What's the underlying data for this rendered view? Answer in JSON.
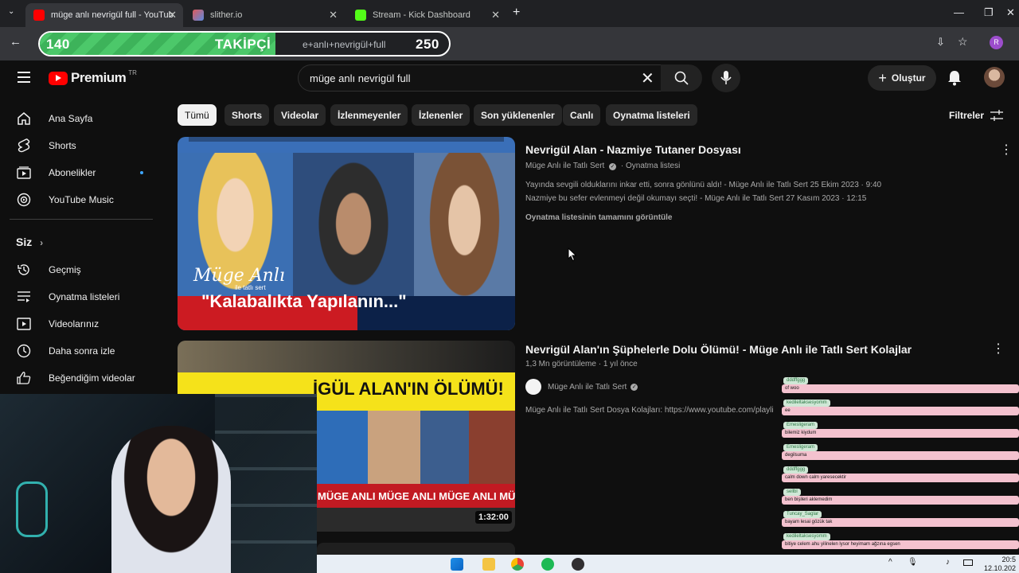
{
  "browser": {
    "tabs": [
      {
        "title": "müge anlı nevrigül full - YouTub"
      },
      {
        "title": "slither.io"
      },
      {
        "title": "Stream - Kick Dashboard"
      }
    ],
    "address": "e+anlı+nevrigül+full",
    "overlay": {
      "left": "140",
      "label": "TAKİPÇİ",
      "right": "250"
    }
  },
  "youtube": {
    "logo": "Premium",
    "region": "TR",
    "search_value": "müge anlı nevrigül full",
    "create_label": "Oluştur",
    "sidebar": {
      "items": [
        {
          "label": "Ana Sayfa",
          "icon": "home-icon"
        },
        {
          "label": "Shorts",
          "icon": "shorts-icon"
        },
        {
          "label": "Abonelikler",
          "icon": "subscriptions-icon"
        },
        {
          "label": "YouTube Music",
          "icon": "music-icon"
        }
      ],
      "section": "Siz",
      "you_items": [
        {
          "label": "Geçmiş",
          "icon": "history-icon"
        },
        {
          "label": "Oynatma listeleri",
          "icon": "playlist-icon"
        },
        {
          "label": "Videolarınız",
          "icon": "your-videos-icon"
        },
        {
          "label": "Daha sonra izle",
          "icon": "watch-later-icon"
        },
        {
          "label": "Beğendiğim videolar",
          "icon": "like-icon"
        }
      ]
    },
    "chips": [
      "Tümü",
      "Shorts",
      "Videolar",
      "İzlenmeyenler",
      "İzlenenler",
      "Son yüklenenler",
      "Canlı",
      "Oynatma listeleri"
    ],
    "filters_label": "Filtreler",
    "results": [
      {
        "title": "Nevrigül Alan - Nazmiye Tutaner Dosyası",
        "channel": "Müge Anlı ile Tatlı Sert",
        "kind": "Oynatma listesi",
        "line1": "Yayında sevgili olduklarını inkar etti, sonra gönlünü aldı! - Müge Anlı ile Tatlı Sert 25 Ekim 2023 · 9:40",
        "line2": "Nazmiye bu sefer evlenmeyi değil okumayı seçti! - Müge Anlı ile Tatlı Sert 27 Kasım 2023 · 12:15",
        "view_all": "Oynatma listesinin tamamını görüntüle",
        "thumb_brand": "Müge Anlı",
        "thumb_brand_sub": "ile tatlı sert",
        "thumb_caption": "\"Kalabalıkta Yapılanın...\""
      },
      {
        "title": "Nevrigül Alan'ın Şüphelerle Dolu Ölümü! - Müge Anlı ile Tatlı Sert Kolajlar",
        "views": "1,3 Mn görüntüleme",
        "age": "1 yıl önce",
        "channel": "Müge Anlı ile Tatlı Sert",
        "desc": "Müge Anlı ile Tatlı Sert Dosya Kolajları: https://www.youtube.com/playli",
        "thumb_headline": "İGÜL ALAN'IN ÖLÜMÜ!",
        "thumb_band": "MÜGE ANLI   MÜGE ANLI   MÜGE ANLI   MÜGE A",
        "duration": "1:32:00"
      }
    ]
  },
  "chat": [
    {
      "name": "dddffggg",
      "msg": "of woo"
    },
    {
      "name": "kedileltaksesyomm",
      "msg": "ee"
    },
    {
      "name": "Emesligeram",
      "msg": "bilemiz kiydum"
    },
    {
      "name": "Emesligeram",
      "msg": "degilsuma"
    },
    {
      "name": "dddffggg",
      "msg": "calm down calm yaresecektir"
    },
    {
      "name": "sellbl",
      "msg": "ben bişileri aklemedim"
    },
    {
      "name": "Tuncay_Saglar",
      "msg": "bayam lesai gözük tak"
    },
    {
      "name": "kedileltaksesyomm",
      "msg": "bitiye celem ahu yilinelen lysor heyimam ağzına egsen"
    }
  ],
  "taskbar": {
    "time": "20:5",
    "date": "12.10.202"
  }
}
